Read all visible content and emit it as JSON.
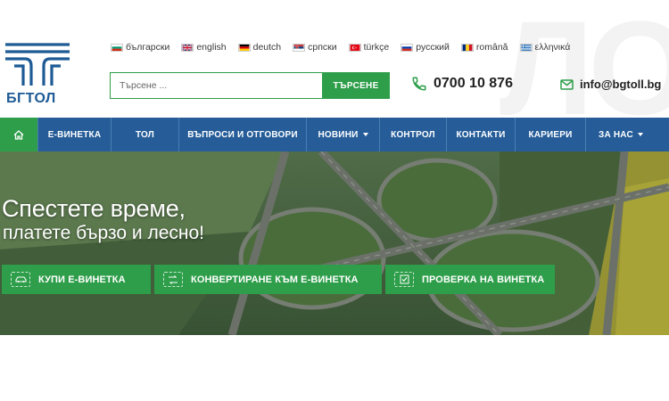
{
  "brand": {
    "logo_text": "БГТОЛ",
    "watermark": "ЛО"
  },
  "languages": [
    {
      "label": "български",
      "flag": "bg"
    },
    {
      "label": "english",
      "flag": "gb"
    },
    {
      "label": "deutch",
      "flag": "de"
    },
    {
      "label": "српски",
      "flag": "rs"
    },
    {
      "label": "türkçe",
      "flag": "tr"
    },
    {
      "label": "русский",
      "flag": "ru"
    },
    {
      "label": "română",
      "flag": "ro"
    },
    {
      "label": "ελληνικά",
      "flag": "gr"
    }
  ],
  "search": {
    "placeholder": "Търсене ...",
    "button_label": "ТЪРСЕНЕ"
  },
  "contact": {
    "phone": "0700 10 876",
    "email": "info@bgtoll.bg"
  },
  "nav": {
    "items": [
      {
        "label": "Е-ВИНЕТКА"
      },
      {
        "label": "ТОЛ"
      },
      {
        "label": "ВЪПРОСИ И ОТГОВОРИ"
      },
      {
        "label": "НОВИНИ"
      },
      {
        "label": "КОНТРОЛ"
      },
      {
        "label": "КОНТАКТИ"
      },
      {
        "label": "КАРИЕРИ"
      },
      {
        "label": "ЗА НАС"
      }
    ]
  },
  "hero": {
    "title": "Спестете време,",
    "subtitle": "платете бързо и лесно!",
    "buttons": [
      {
        "label": "КУПИ Е-ВИНЕТКА"
      },
      {
        "label": "КОНВЕРТИРАНЕ КЪМ Е-ВИНЕТКА"
      },
      {
        "label": "ПРОВЕРКА НА ВИНЕТКА"
      }
    ]
  },
  "colors": {
    "brand_blue": "#265d99",
    "accent_green": "#2e9e4a"
  }
}
